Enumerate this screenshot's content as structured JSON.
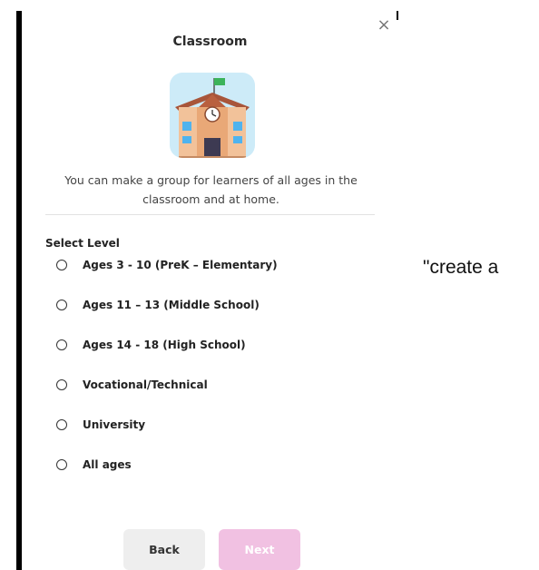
{
  "dialog": {
    "close_glyph": "×",
    "title": "Classroom",
    "illustration_icon": "school-building-icon",
    "description": "You can make a group for learners of all ages in the classroom and at home.",
    "select_label": "Select Level",
    "levels": [
      {
        "label": "Ages 3 - 10 (PreK – Elementary)",
        "selected": false
      },
      {
        "label": "Ages 11 – 13 (Middle School)",
        "selected": false
      },
      {
        "label": "Ages 14 - 18 (High School)",
        "selected": false
      },
      {
        "label": "Vocational/Technical",
        "selected": false
      },
      {
        "label": "University",
        "selected": false
      },
      {
        "label": "All ages",
        "selected": false
      }
    ],
    "back_label": "Back",
    "next_label": "Next"
  },
  "side_text": "\"create a",
  "colors": {
    "next_disabled_bg": "#f1c1e2",
    "back_bg": "#eeeeee",
    "illustration_bg": "#cdebf8"
  }
}
